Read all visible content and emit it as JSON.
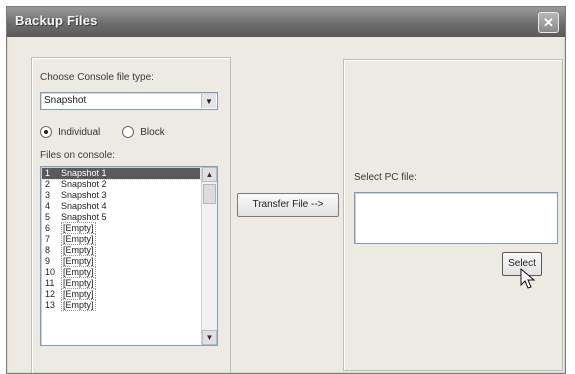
{
  "window": {
    "title": "Backup Files"
  },
  "console_group": {
    "file_type_label": "Choose Console file type:",
    "file_type_value": "Snapshot",
    "radio": {
      "individual_label": "Individual",
      "block_label": "Block",
      "selected": "Individual"
    },
    "files_label": "Files on console:",
    "files": [
      {
        "num": "1",
        "name": "Snapshot 1",
        "selected": true
      },
      {
        "num": "2",
        "name": "Snapshot 2"
      },
      {
        "num": "3",
        "name": "Snapshot 3"
      },
      {
        "num": "4",
        "name": "Snapshot 4"
      },
      {
        "num": "5",
        "name": "Snapshot 5"
      },
      {
        "num": "6",
        "name": "[Empty]"
      },
      {
        "num": "7",
        "name": "[Empty]"
      },
      {
        "num": "8",
        "name": "[Empty]"
      },
      {
        "num": "9",
        "name": "[Empty]"
      },
      {
        "num": "10",
        "name": "[Empty]"
      },
      {
        "num": "11",
        "name": "[Empty]"
      },
      {
        "num": "12",
        "name": "[Empty]"
      },
      {
        "num": "13",
        "name": "[Empty]"
      }
    ]
  },
  "transfer_button": {
    "label": "Transfer File -->"
  },
  "pc_group": {
    "select_label": "Select PC file:",
    "input_value": "",
    "select_button": "Select"
  },
  "icons": {
    "close": "close-icon",
    "dropdown": "chevron-down-icon",
    "scroll_up": "chevron-up-icon",
    "scroll_down": "chevron-down-icon",
    "cursor": "mouse-pointer-icon"
  }
}
